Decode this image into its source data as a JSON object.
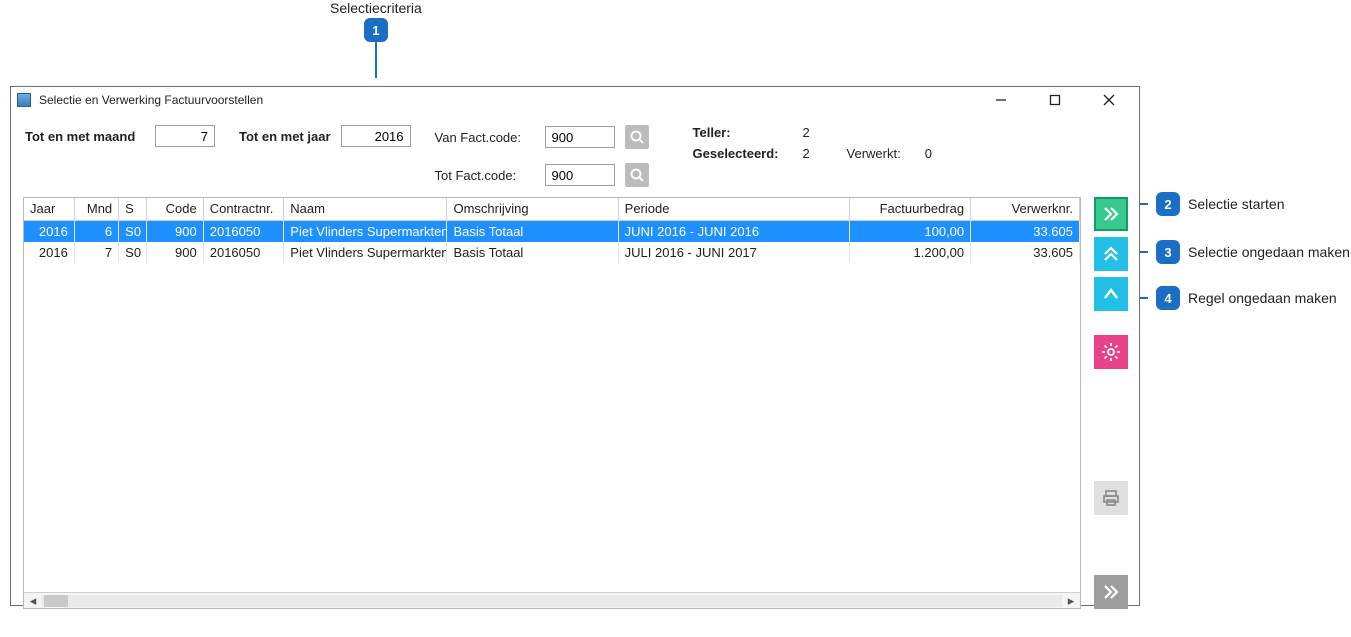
{
  "callouts": {
    "top": {
      "label": "Selectiecriteria",
      "num": "1"
    },
    "side": [
      {
        "num": "2",
        "label": "Selectie starten"
      },
      {
        "num": "3",
        "label": "Selectie ongedaan maken"
      },
      {
        "num": "4",
        "label": "Regel ongedaan maken"
      }
    ]
  },
  "window": {
    "title": "Selectie en Verwerking Factuurvoorstellen"
  },
  "criteria": {
    "month_label": "Tot en met maand",
    "month_value": "7",
    "year_label": "Tot en met jaar",
    "year_value": "2016",
    "from_code_label": "Van Fact.code:",
    "from_code_value": "900",
    "to_code_label": "Tot Fact.code:",
    "to_code_value": "900",
    "stats": {
      "teller_label": "Teller:",
      "teller_value": "2",
      "geselecteerd_label": "Geselecteerd:",
      "geselecteerd_value": "2",
      "verwerkt_label": "Verwerkt:",
      "verwerkt_value": "0"
    }
  },
  "table": {
    "columns": [
      "Jaar",
      "Mnd",
      "S",
      "Code",
      "Contractnr.",
      "Naam",
      "Omschrijving",
      "Periode",
      "Factuurbedrag",
      "Verwerknr."
    ],
    "rows": [
      {
        "selected": true,
        "jaar": "2016",
        "mnd": "6",
        "s": "S0",
        "code": "900",
        "contractnr": "2016050",
        "naam": "Piet Vlinders Supermarkten B",
        "omschrijving": "Basis Totaal",
        "periode": "JUNI 2016 - JUNI 2016",
        "bedrag": "100,00",
        "verwerknr": "33.605"
      },
      {
        "selected": false,
        "jaar": "2016",
        "mnd": "7",
        "s": "S0",
        "code": "900",
        "contractnr": "2016050",
        "naam": "Piet Vlinders Supermarkten B",
        "omschrijving": "Basis Totaal",
        "periode": "JULI 2016 - JUNI 2017",
        "bedrag": "1.200,00",
        "verwerknr": "33.605"
      }
    ]
  },
  "icons": {
    "start": "start",
    "undo_selection": "double-chevron-up",
    "undo_row": "chevron-up",
    "settings": "gear",
    "print": "print",
    "next": "double-chevron-right"
  }
}
